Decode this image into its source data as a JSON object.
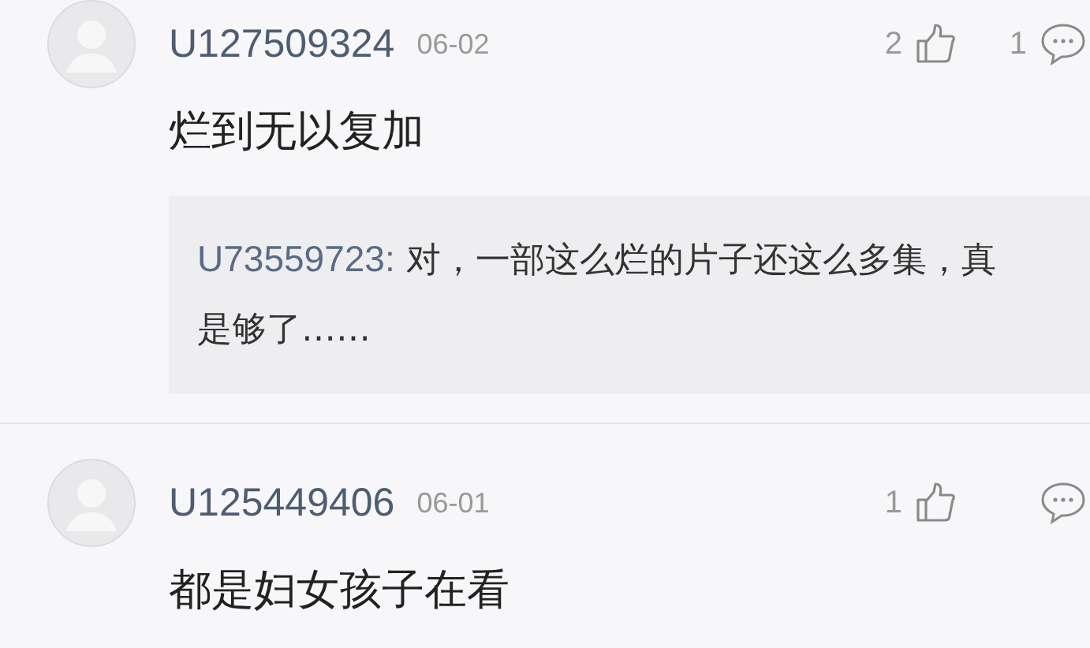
{
  "comments": [
    {
      "user": "U127509324",
      "date": "06-02",
      "likes": "2",
      "replies_count": "1",
      "text": "烂到无以复加",
      "replies": [
        {
          "user": "U73559723:",
          "text": "对，一部这么烂的片子还这么多集，真是够了……"
        }
      ]
    },
    {
      "user": "U125449406",
      "date": "06-01",
      "likes": "1",
      "text": "都是妇女孩子在看"
    }
  ]
}
